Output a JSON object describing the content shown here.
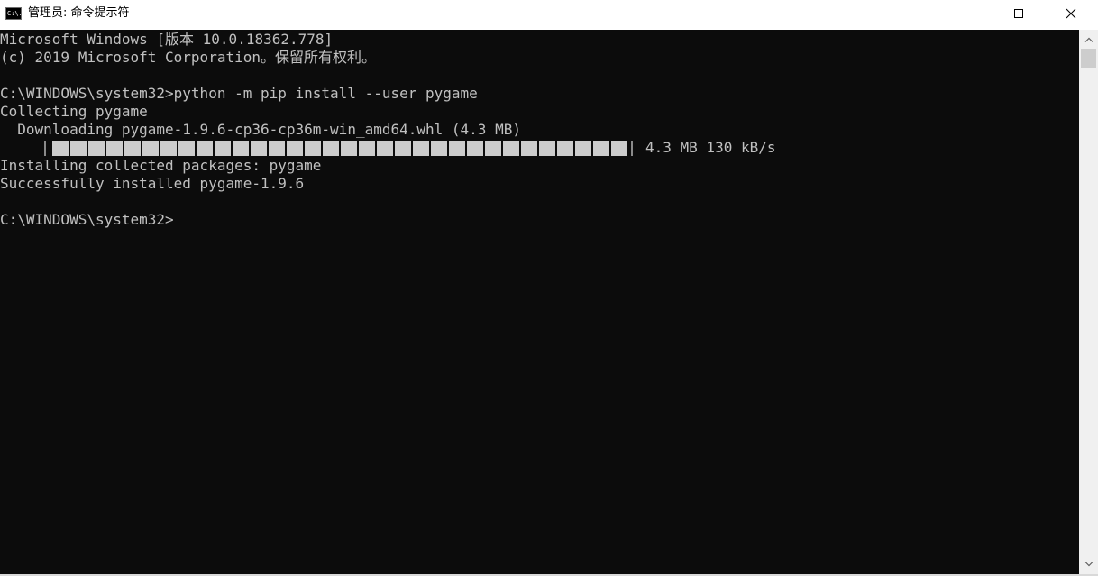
{
  "window": {
    "title": "管理员: 命令提示符",
    "app_icon_text": "C:\\.",
    "controls": {
      "minimize": "minimize-icon",
      "maximize": "maximize-icon",
      "close": "close-icon"
    }
  },
  "console": {
    "colors": {
      "background": "#0c0c0c",
      "text": "#c0c0c0"
    },
    "lines": {
      "l0": "Microsoft Windows [版本 10.0.18362.778]",
      "l1": "(c) 2019 Microsoft Corporation。保留所有权利。",
      "l2": "",
      "l3": "C:\\WINDOWS\\system32>python -m pip install --user pygame",
      "l4": "Collecting pygame",
      "l5": "  Downloading pygame-1.9.6-cp36-cp36m-win_amd64.whl (4.3 MB)",
      "l7": "Installing collected packages: pygame",
      "l8": "Successfully installed pygame-1.9.6",
      "l9": "",
      "l10": "C:\\WINDOWS\\system32>"
    },
    "progress": {
      "fraction": 1.0,
      "info": "4.3 MB 130 kB/s"
    }
  },
  "scrollbar": {
    "up_icon": "chevron-up-icon",
    "down_icon": "chevron-down-icon"
  }
}
